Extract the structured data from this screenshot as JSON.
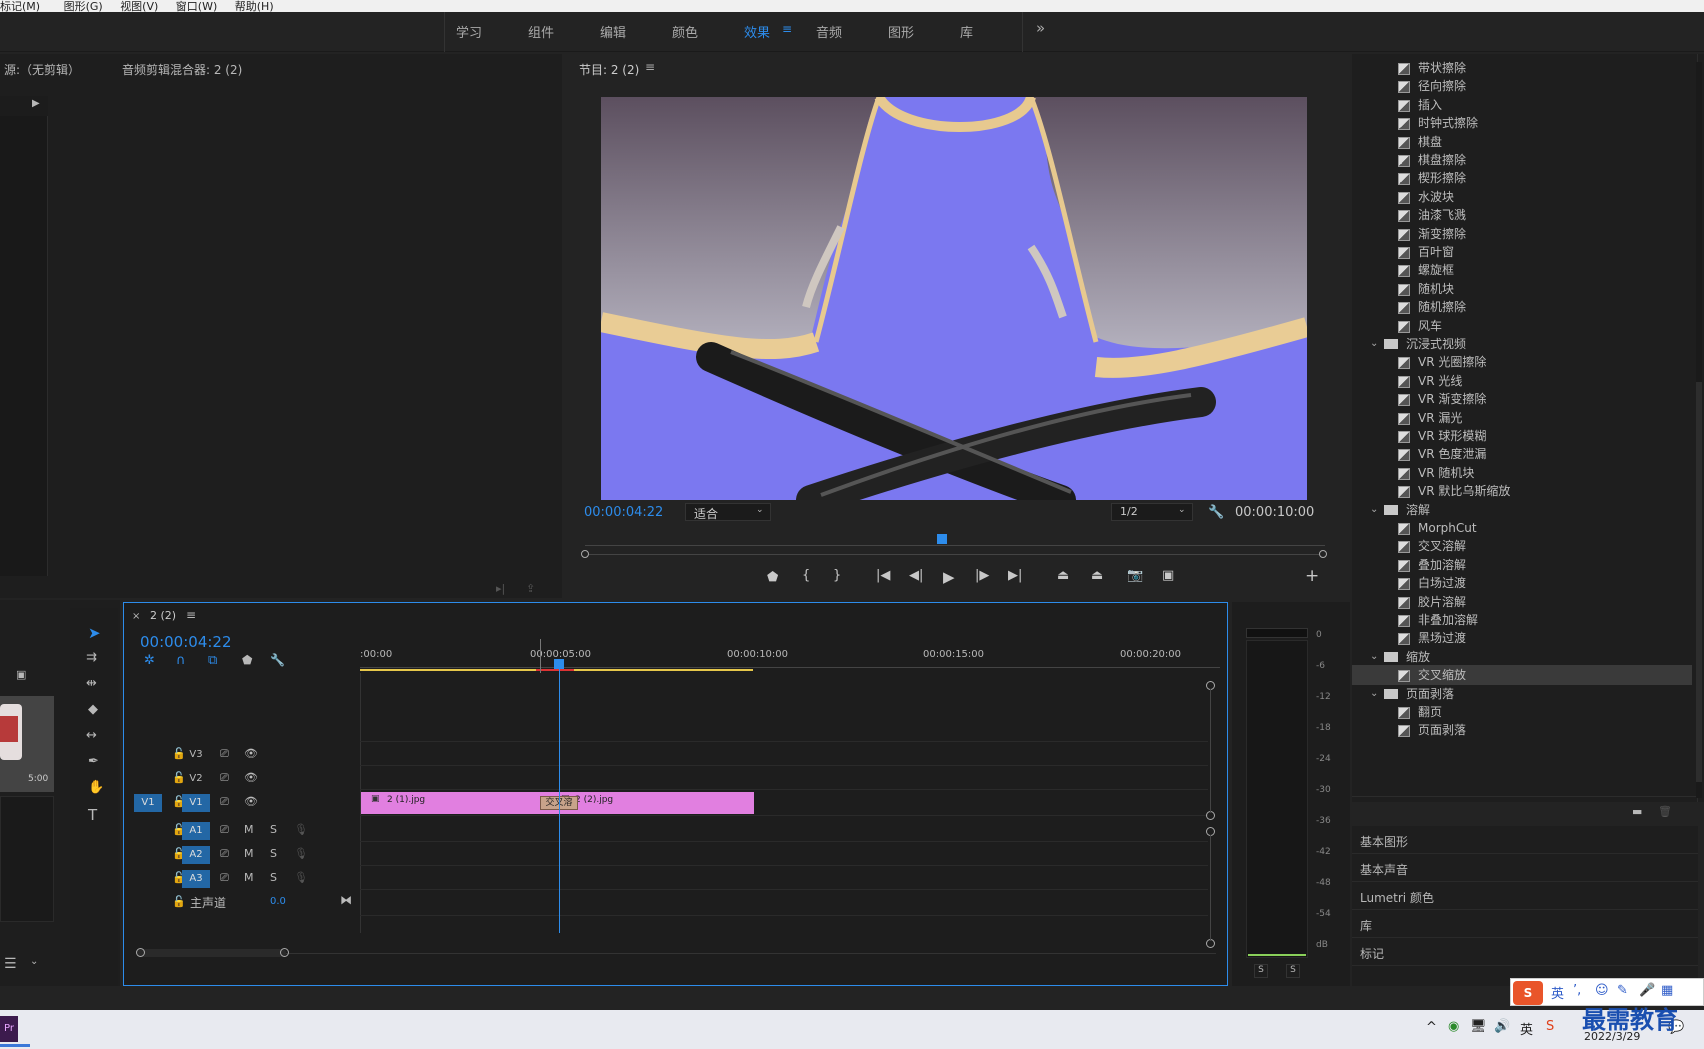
{
  "menubar": {
    "items": [
      "标记(M)",
      "图形(G)",
      "视图(V)",
      "窗口(W)",
      "帮助(H)"
    ]
  },
  "workspaces": {
    "tabs": [
      "学习",
      "组件",
      "编辑",
      "颜色",
      "效果",
      "音频",
      "图形",
      "库"
    ],
    "active": "效果",
    "more": "»"
  },
  "source_panel": {
    "title": "源:（无剪辑）",
    "tab2": "音频剪辑混合器: 2 (2)"
  },
  "program": {
    "title": "节目: 2 (2)",
    "timecode": "00:00:04:22",
    "fit": "适合",
    "resolution": "1/2",
    "duration": "00:00:10:00"
  },
  "effects": {
    "items": [
      {
        "label": "带状擦除",
        "type": "item"
      },
      {
        "label": "径向擦除",
        "type": "item"
      },
      {
        "label": "插入",
        "type": "item"
      },
      {
        "label": "时钟式擦除",
        "type": "item"
      },
      {
        "label": "棋盘",
        "type": "item"
      },
      {
        "label": "棋盘擦除",
        "type": "item"
      },
      {
        "label": "楔形擦除",
        "type": "item"
      },
      {
        "label": "水波块",
        "type": "item"
      },
      {
        "label": "油漆飞溅",
        "type": "item"
      },
      {
        "label": "渐变擦除",
        "type": "item"
      },
      {
        "label": "百叶窗",
        "type": "item"
      },
      {
        "label": "螺旋框",
        "type": "item"
      },
      {
        "label": "随机块",
        "type": "item"
      },
      {
        "label": "随机擦除",
        "type": "item"
      },
      {
        "label": "风车",
        "type": "item"
      },
      {
        "label": "沉浸式视频",
        "type": "folder"
      },
      {
        "label": "VR 光圈擦除",
        "type": "item"
      },
      {
        "label": "VR 光线",
        "type": "item"
      },
      {
        "label": "VR 渐变擦除",
        "type": "item"
      },
      {
        "label": "VR 漏光",
        "type": "item"
      },
      {
        "label": "VR 球形模糊",
        "type": "item"
      },
      {
        "label": "VR 色度泄漏",
        "type": "item"
      },
      {
        "label": "VR 随机块",
        "type": "item"
      },
      {
        "label": "VR 默比乌斯缩放",
        "type": "item"
      },
      {
        "label": "溶解",
        "type": "folder"
      },
      {
        "label": "MorphCut",
        "type": "item"
      },
      {
        "label": "交叉溶解",
        "type": "item"
      },
      {
        "label": "叠加溶解",
        "type": "item"
      },
      {
        "label": "白场过渡",
        "type": "item"
      },
      {
        "label": "胶片溶解",
        "type": "item"
      },
      {
        "label": "非叠加溶解",
        "type": "item"
      },
      {
        "label": "黑场过渡",
        "type": "item"
      },
      {
        "label": "缩放",
        "type": "folder"
      },
      {
        "label": "交叉缩放",
        "type": "item",
        "selected": true
      },
      {
        "label": "页面剥落",
        "type": "folder"
      },
      {
        "label": "翻页",
        "type": "item"
      },
      {
        "label": "页面剥落",
        "type": "item"
      }
    ],
    "panels": [
      "基本图形",
      "基本声音",
      "Lumetri 颜色",
      "库",
      "标记"
    ]
  },
  "timeline": {
    "sequence": "2 (2)",
    "timecode": "00:00:04:22",
    "ruler": [
      ":00:00",
      "00:00:05:00",
      "00:00:10:00",
      "00:00:15:00",
      "00:00:20:00"
    ],
    "tracks_video": [
      "V3",
      "V2",
      "V1"
    ],
    "tracks_audio": [
      "A1",
      "A2",
      "A3"
    ],
    "source_patch_v": "V1",
    "master": "主声道",
    "master_value": "0.0",
    "m_label": "M",
    "s_label": "S",
    "clip1": "2 (1).jpg",
    "clip2": "2 (2).jpg",
    "transition": "交叉溶",
    "project_time": "5:00"
  },
  "meter": {
    "scale": [
      "0",
      "-6",
      "-12",
      "-18",
      "-24",
      "-30",
      "-36",
      "-42",
      "-48",
      "-54",
      "dB"
    ],
    "s1": "S",
    "s2": "S"
  },
  "taskbar": {
    "date": "2022/3/29",
    "watermark": "最需教育",
    "ime": "英"
  },
  "colors": {
    "accent": "#2d8ceb",
    "clip": "#e17fe0",
    "video_bg": "#7b78f0"
  }
}
